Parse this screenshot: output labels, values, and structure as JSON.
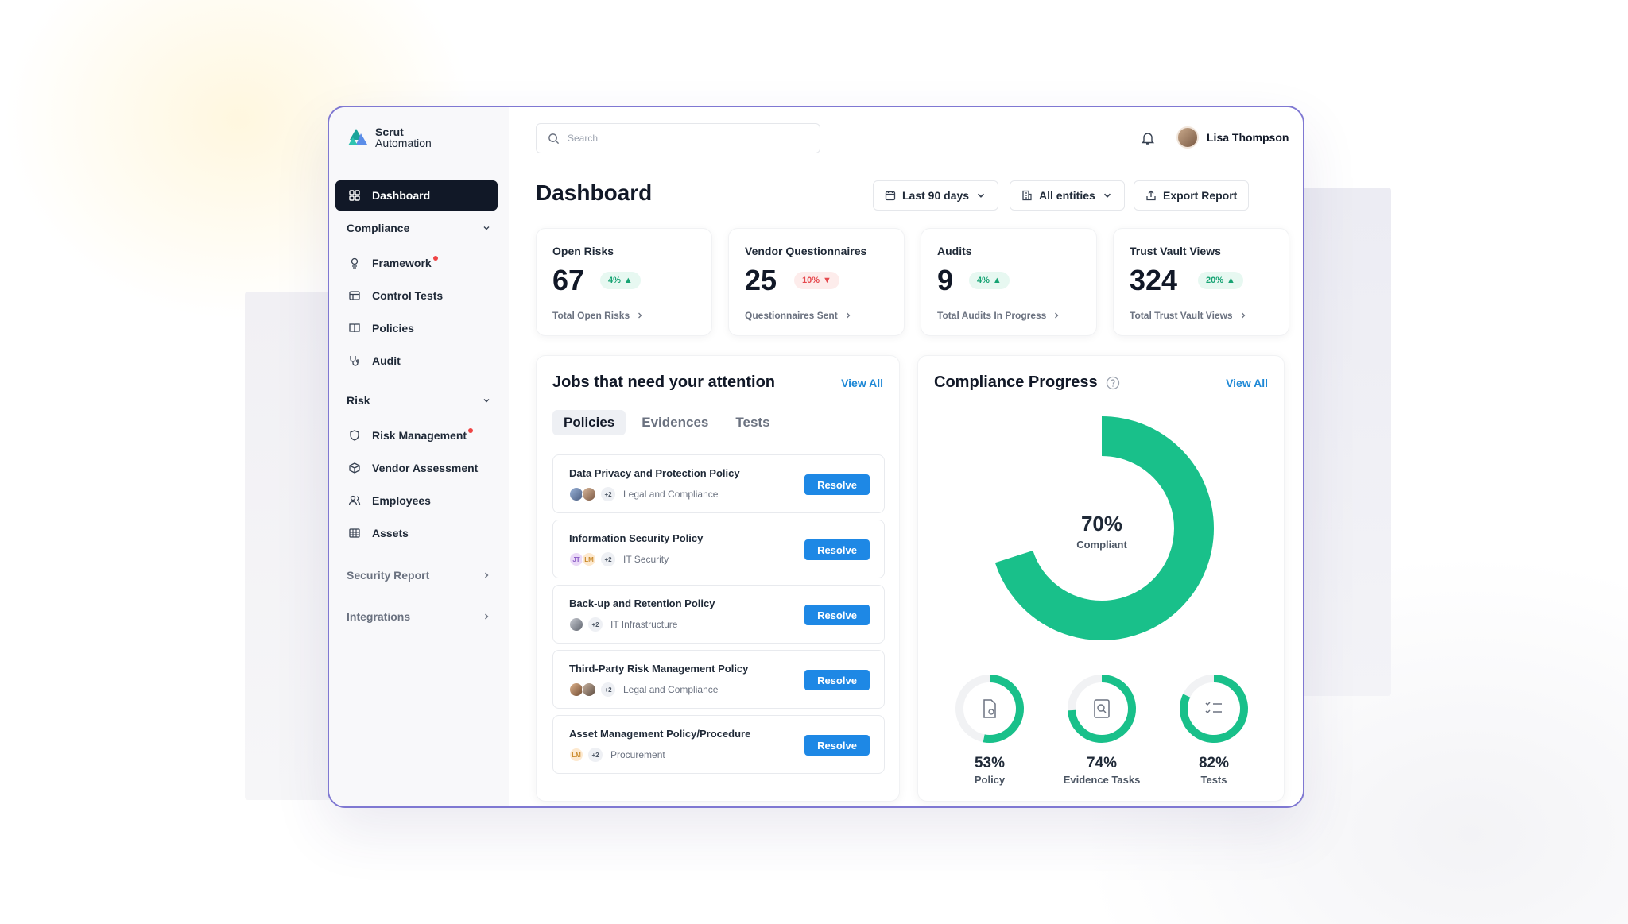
{
  "app": {
    "name_line1": "Scrut",
    "name_line2": "Automation"
  },
  "sidebar": {
    "dashboard": "Dashboard",
    "compliance": {
      "label": "Compliance",
      "items": [
        {
          "label": "Framework",
          "dot": true,
          "icon": "framework-icon"
        },
        {
          "label": "Control Tests",
          "icon": "control-tests-icon"
        },
        {
          "label": "Policies",
          "icon": "book-icon"
        },
        {
          "label": "Audit",
          "icon": "stethoscope-icon"
        }
      ]
    },
    "risk": {
      "label": "Risk",
      "items": [
        {
          "label": "Risk Management",
          "dot": true,
          "icon": "shield-icon"
        },
        {
          "label": "Vendor Assessment",
          "icon": "box-icon"
        },
        {
          "label": "Employees",
          "icon": "users-icon"
        },
        {
          "label": "Assets",
          "icon": "grid-icon"
        }
      ]
    },
    "security_report": "Security Report",
    "integrations": "Integrations"
  },
  "header": {
    "search_placeholder": "Search",
    "user_name": "Lisa Thompson",
    "page_title": "Dashboard",
    "date_filter": "Last 90 days",
    "entity_filter": "All entities",
    "export_label": "Export Report"
  },
  "stats": [
    {
      "title": "Open Risks",
      "value": "67",
      "change": "4%",
      "direction": "up",
      "link": "Total Open Risks"
    },
    {
      "title": "Vendor Questionnaires",
      "value": "25",
      "change": "10%",
      "direction": "down",
      "link": "Questionnaires Sent"
    },
    {
      "title": "Audits",
      "value": "9",
      "change": "4%",
      "direction": "up",
      "link": "Total Audits In Progress"
    },
    {
      "title": "Trust Vault Views",
      "value": "324",
      "change": "20%",
      "direction": "up",
      "link": "Total Trust Vault Views"
    }
  ],
  "jobs": {
    "title": "Jobs that need your attention",
    "view_all": "View All",
    "tabs": [
      "Policies",
      "Evidences",
      "Tests"
    ],
    "active_tab": "Policies",
    "resolve_label": "Resolve",
    "items": [
      {
        "title": "Data Privacy and Protection Policy",
        "extra": "+2",
        "category": "Legal and Compliance",
        "initials": []
      },
      {
        "title": "Information Security Policy",
        "extra": "+2",
        "category": "IT Security",
        "initials": [
          "JT",
          "LM"
        ]
      },
      {
        "title": "Back-up and Retention Policy",
        "extra": "+2",
        "category": "IT Infrastructure",
        "initials": []
      },
      {
        "title": "Third-Party Risk Management Policy",
        "extra": "+2",
        "category": "Legal and Compliance",
        "initials": []
      },
      {
        "title": "Asset Management Policy/Procedure",
        "extra": "+2",
        "category": "Procurement",
        "initials": [
          "LM"
        ]
      }
    ]
  },
  "compliance": {
    "title": "Compliance Progress",
    "view_all": "View All",
    "overall_value": "70%",
    "overall_label": "Compliant",
    "overall_fraction": 0.7,
    "gauges": [
      {
        "value": "53%",
        "label": "Policy",
        "fraction": 0.53,
        "icon": "policy-doc-icon"
      },
      {
        "value": "74%",
        "label": "Evidence Tasks",
        "fraction": 0.74,
        "icon": "evidence-search-icon"
      },
      {
        "value": "82%",
        "label": "Tests",
        "fraction": 0.82,
        "icon": "checklist-icon"
      }
    ],
    "accent_color": "#19c08a"
  }
}
